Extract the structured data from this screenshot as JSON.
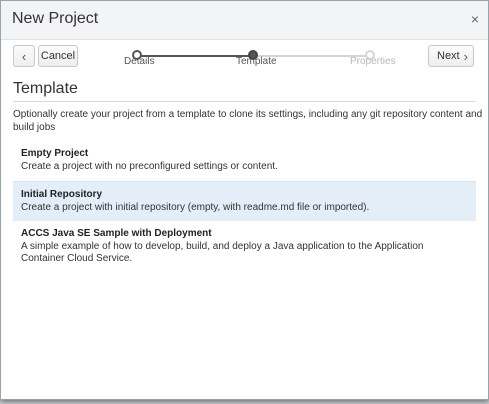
{
  "dialog": {
    "title": "New Project",
    "close_glyph": "×"
  },
  "wizard": {
    "back_glyph": "‹",
    "cancel_label": "Cancel",
    "next_label": "Next",
    "next_glyph": "›",
    "steps": [
      {
        "label": "Details",
        "state": "done"
      },
      {
        "label": "Template",
        "state": "current"
      },
      {
        "label": "Properties",
        "state": "pending"
      }
    ]
  },
  "template": {
    "heading": "Template",
    "intro": "Optionally create your project from a template to clone its settings, including any git repository content and build jobs",
    "options": [
      {
        "title": "Empty Project",
        "description": "Create a project with no preconfigured settings or content.",
        "selected": false
      },
      {
        "title": "Initial Repository",
        "description": "Create a project with initial repository (empty, with readme.md file or imported).",
        "selected": true
      },
      {
        "title": "ACCS Java SE Sample with Deployment",
        "description": "A simple example of how to develop, build, and deploy a Java application to the Application Container Cloud Service.",
        "selected": false
      }
    ]
  },
  "colors": {
    "selected_row": "#e3eef9",
    "titlebar": "#f3f4f5",
    "active_step": "#555555",
    "pending_step": "#d3d6d8"
  }
}
